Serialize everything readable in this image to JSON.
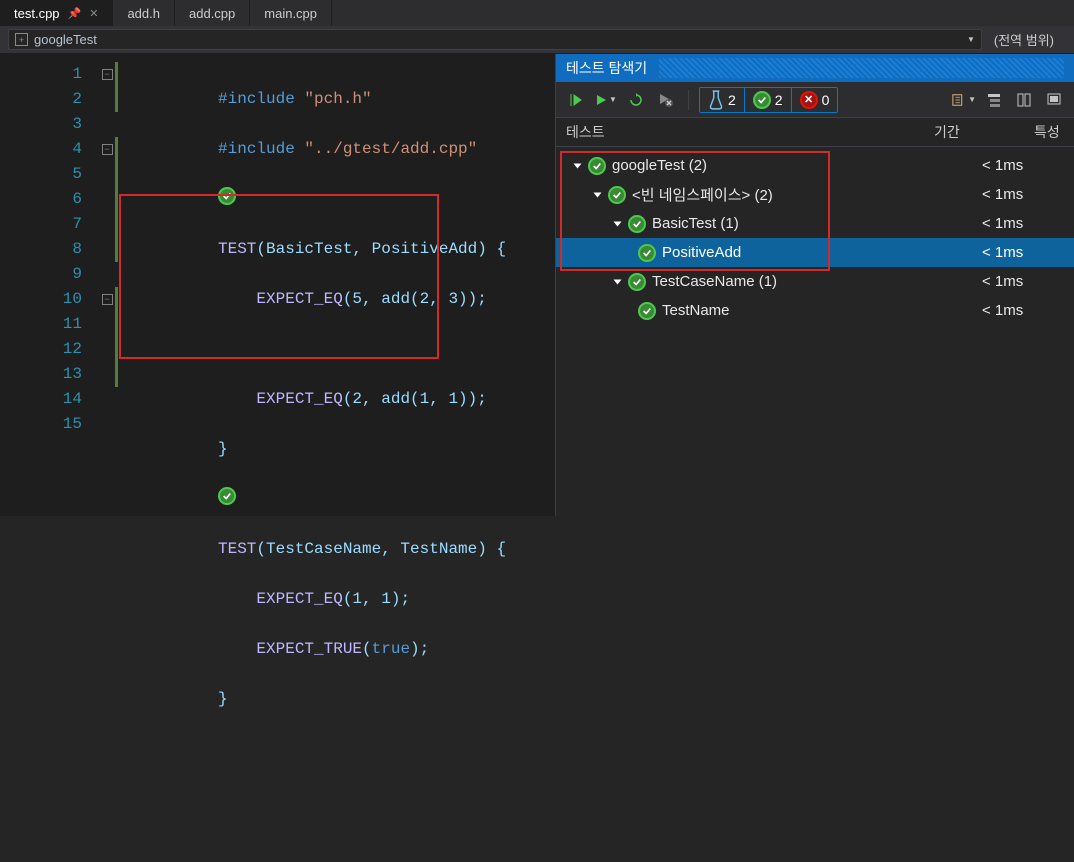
{
  "tabs": [
    {
      "label": "test.cpp",
      "active": true,
      "pinned": true,
      "closeable": true
    },
    {
      "label": "add.h",
      "active": false
    },
    {
      "label": "add.cpp",
      "active": false
    },
    {
      "label": "main.cpp",
      "active": false
    }
  ],
  "scope": {
    "left": "googleTest",
    "right": "(전역 범위)"
  },
  "code": {
    "lines": [
      1,
      2,
      3,
      4,
      5,
      6,
      7,
      8,
      9,
      10,
      11,
      12,
      13,
      14,
      15
    ],
    "l1": {
      "kw": "#include ",
      "str": "\"pch.h\""
    },
    "l2": {
      "kw": "#include ",
      "str": "\"../gtest/add.cpp\""
    },
    "l4": {
      "mac": "TEST",
      "args": "(BasicTest, PositiveAdd) {"
    },
    "l5": {
      "mac": "    EXPECT_EQ",
      "args": "(5, add(2, 3));"
    },
    "l7": {
      "mac": "    EXPECT_EQ",
      "args": "(2, add(1, 1));"
    },
    "l8": {
      "txt": "}"
    },
    "l10": {
      "mac": "TEST",
      "args": "(TestCaseName, TestName) {"
    },
    "l11": {
      "mac": "    EXPECT_EQ",
      "args": "(1, 1);"
    },
    "l12": {
      "mac": "    EXPECT_TRUE",
      "args": "(",
      "lit": "true",
      "close": ");"
    },
    "l13": {
      "txt": "}"
    }
  },
  "explorer": {
    "title": "테스트 탐색기",
    "counts": {
      "total": "2",
      "passed": "2",
      "failed": "0"
    },
    "columns": {
      "test": "테스트",
      "duration": "기간",
      "traits": "특성"
    },
    "tree": [
      {
        "label": "googleTest (2)",
        "dur": "< 1ms",
        "depth": 1,
        "open": true
      },
      {
        "label": "<빈 네임스페이스> (2)",
        "dur": "< 1ms",
        "depth": 2,
        "open": true
      },
      {
        "label": "BasicTest (1)",
        "dur": "< 1ms",
        "depth": 3,
        "open": true
      },
      {
        "label": "PositiveAdd",
        "dur": "< 1ms",
        "depth": 4,
        "selected": true
      },
      {
        "label": "TestCaseName (1)",
        "dur": "< 1ms",
        "depth": 3,
        "open": true
      },
      {
        "label": "TestName",
        "dur": "< 1ms",
        "depth": 4
      }
    ]
  }
}
